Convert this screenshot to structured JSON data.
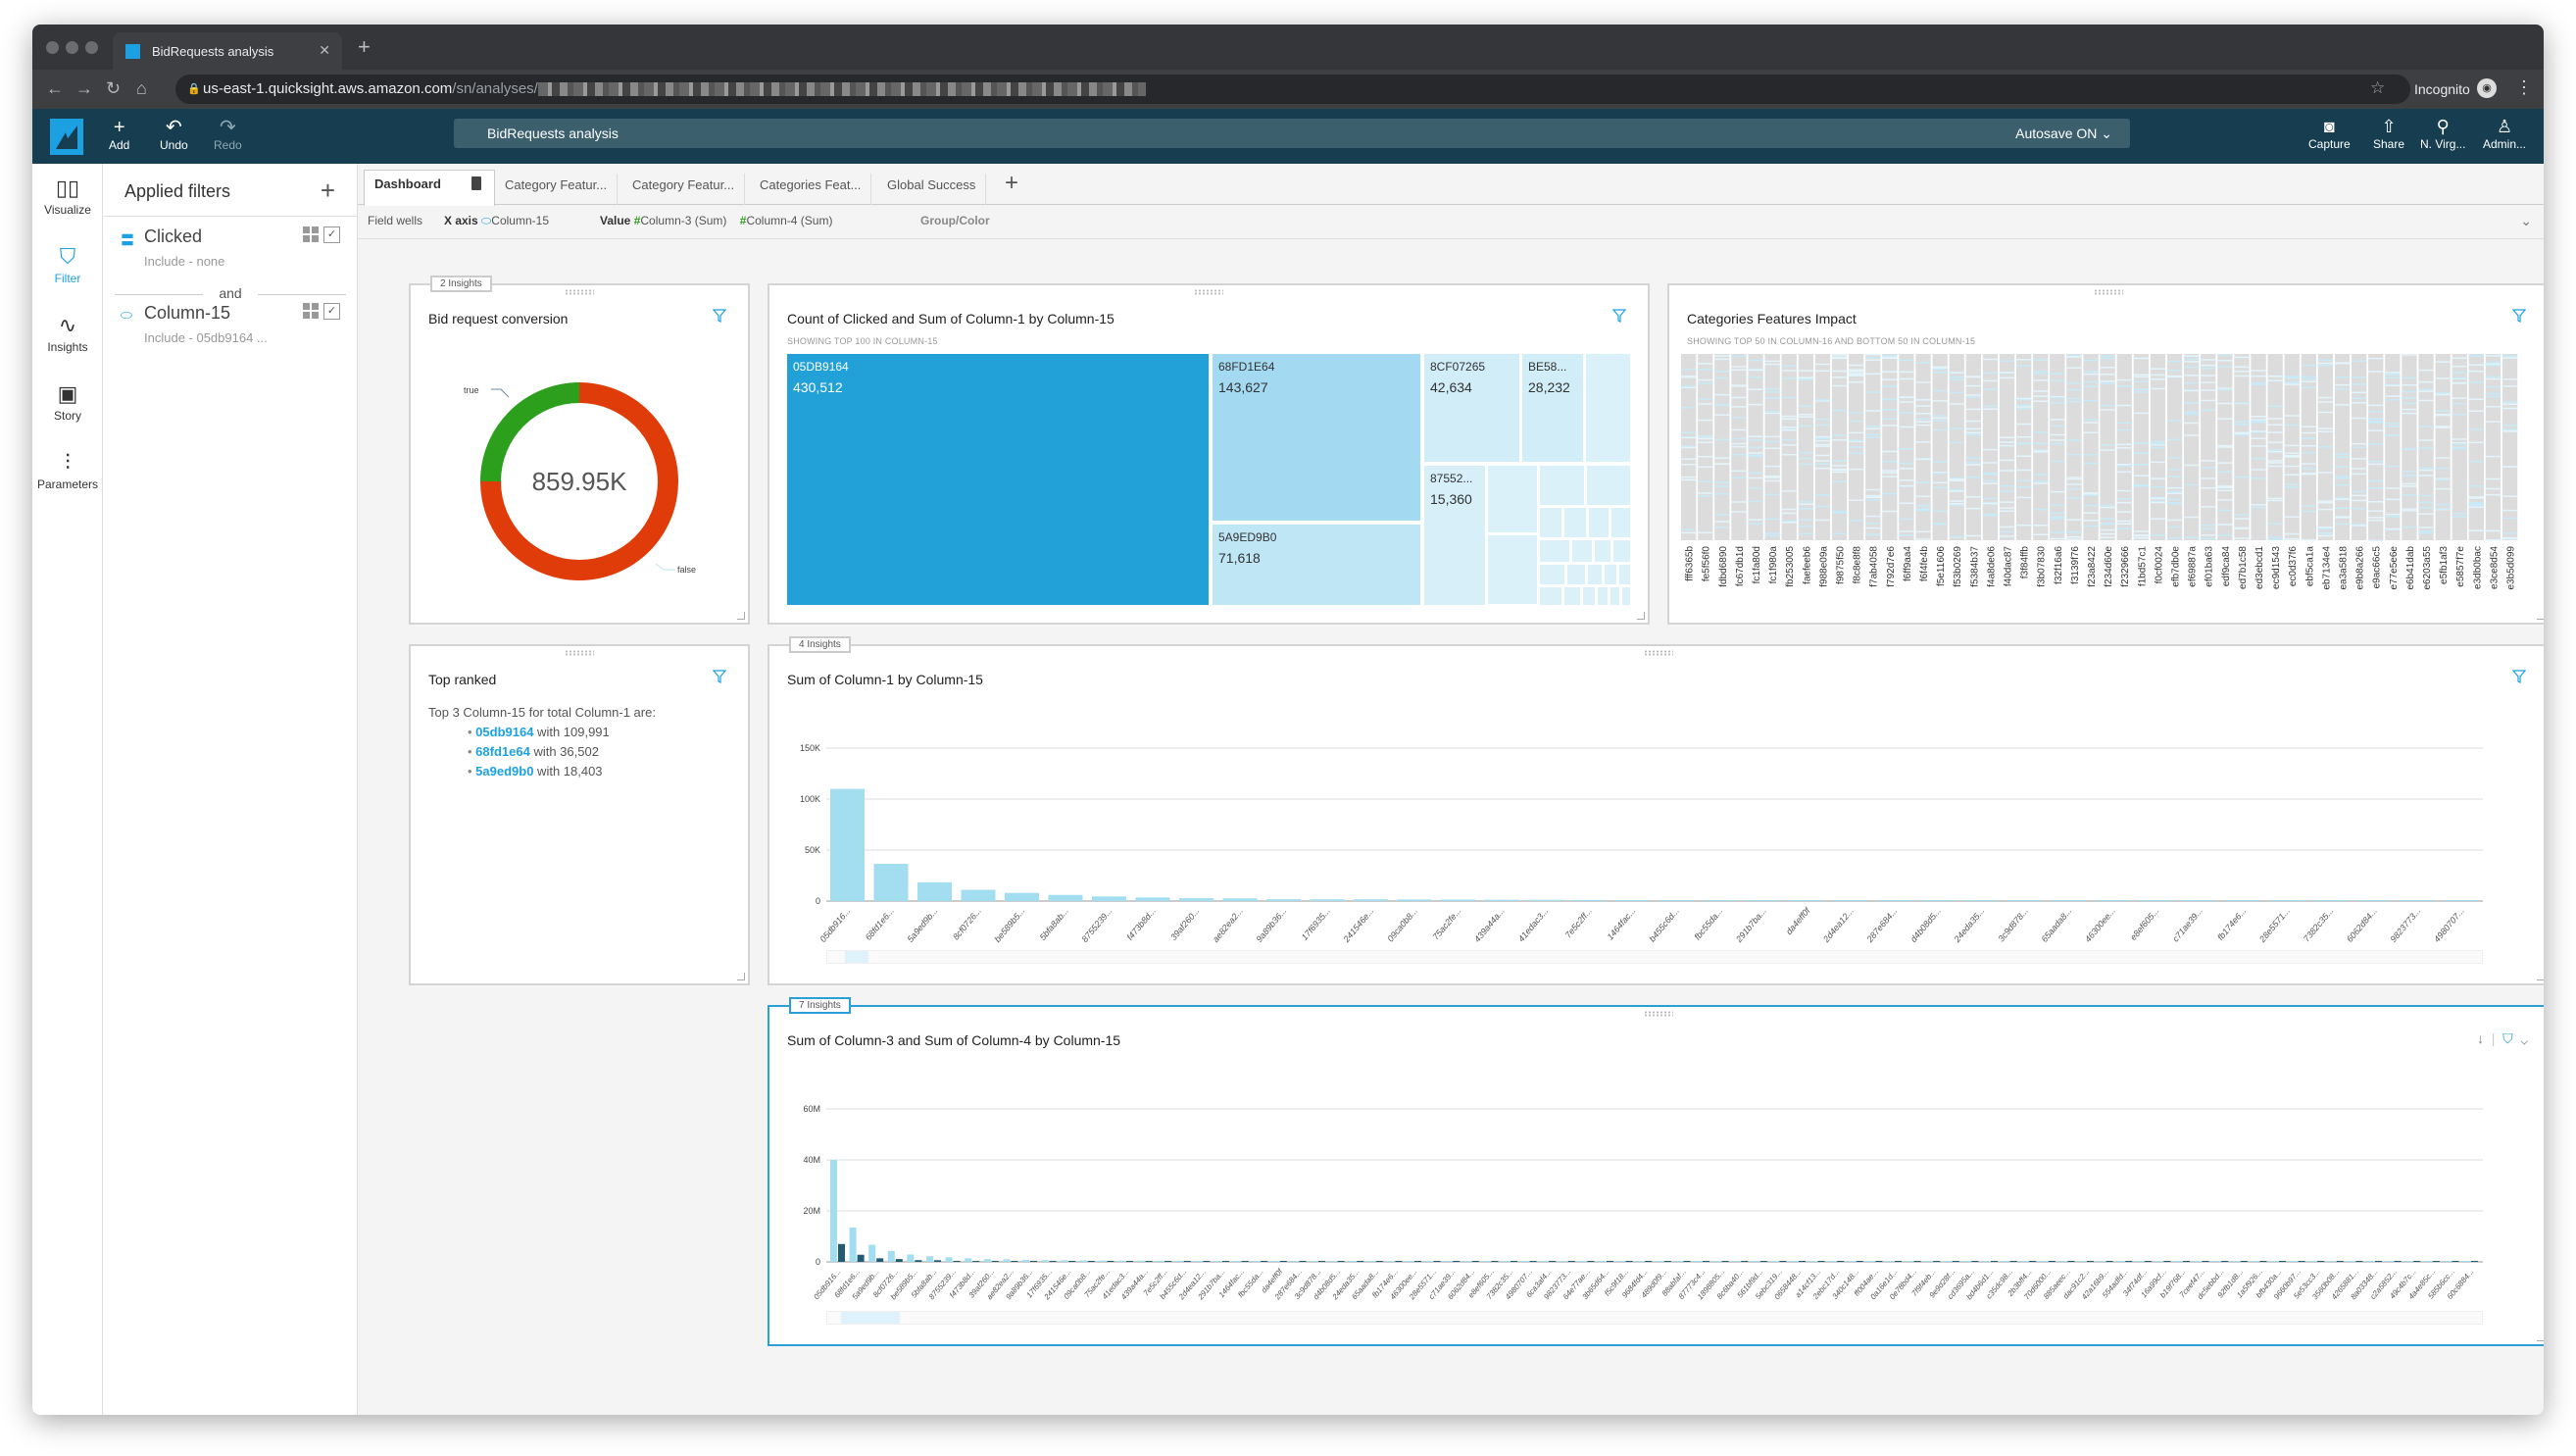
{
  "browser": {
    "tab_title": "BidRequests analysis",
    "url_host": "us-east-1.quicksight.aws.amazon.com",
    "url_path": "/sn/analyses/",
    "incognito_label": "Incognito"
  },
  "appbar": {
    "add": "Add",
    "undo": "Undo",
    "redo": "Redo",
    "analysis_title": "BidRequests analysis",
    "autosave": "Autosave ON",
    "capture": "Capture",
    "share": "Share",
    "region": "N. Virg...",
    "user": "Admin..."
  },
  "rail": {
    "items": [
      {
        "label": "Visualize",
        "icon": "bar-chart-icon"
      },
      {
        "label": "Filter",
        "icon": "filter-icon",
        "active": true
      },
      {
        "label": "Insights",
        "icon": "insights-icon"
      },
      {
        "label": "Story",
        "icon": "story-icon"
      },
      {
        "label": "Parameters",
        "icon": "parameters-icon"
      }
    ]
  },
  "filters": {
    "title": "Applied filters",
    "joiner": "and",
    "items": [
      {
        "name": "Clicked",
        "sub": "Include - none",
        "icon": "measure-icon"
      },
      {
        "name": "Column-15",
        "sub": "Include - 05db9164 ...",
        "icon": "dimension-tag-icon"
      }
    ]
  },
  "sheets": {
    "tabs": [
      "Dashboard",
      "Category Featur...",
      "Category Featur...",
      "Categories Feat...",
      "Global Success"
    ],
    "active": 0
  },
  "fieldwells": {
    "label": "Field wells",
    "xaxis_label": "X axis",
    "xaxis_value": "Column-15",
    "value_label": "Value",
    "values": [
      "Column-3 (Sum)",
      "Column-4 (Sum)"
    ],
    "group_label": "Group/Color"
  },
  "colors": {
    "accent": "#1ba1e2",
    "appbar": "#163e50",
    "donut_true": "#2ca01c",
    "donut_false": "#e03c0a",
    "bar_light": "#a3ddf0",
    "bar_dark": "#235a74"
  },
  "cards": {
    "donut": {
      "insights": "2 Insights",
      "title": "Bid request conversion",
      "center": "859.95K"
    },
    "top_ranked": {
      "title": "Top ranked",
      "intro": "Top 3 Column-15 for total Column-1 are:",
      "items": [
        {
          "key": "05db9164",
          "rest": " with 109,991"
        },
        {
          "key": "68fd1e64",
          "rest": " with 36,502"
        },
        {
          "key": "5a9ed9b0",
          "rest": " with 18,403"
        }
      ]
    },
    "treemap": {
      "title": "Count of Clicked and Sum of Column-1 by Column-15",
      "subtitle": "SHOWING TOP 100 IN COLUMN-15"
    },
    "heatmap": {
      "title": "Categories Features Impact",
      "subtitle": "SHOWING TOP 50 IN COLUMN-16 AND BOTTOM 50 IN COLUMN-15"
    },
    "bar1": {
      "insights": "4 Insights",
      "title": "Sum of Column-1 by Column-15"
    },
    "bar2": {
      "insights": "7 Insights",
      "title": "Sum of Column-3 and Sum of Column-4 by Column-15"
    }
  },
  "chart_data": [
    {
      "id": "donut",
      "type": "pie",
      "title": "Bid request conversion",
      "center_label": "859.95K",
      "categories": [
        "true",
        "false"
      ],
      "values": [
        0.25,
        0.75
      ],
      "value_unit": "fraction"
    },
    {
      "id": "treemap",
      "type": "treemap",
      "title": "Count of Clicked and Sum of Column-1 by Column-15",
      "items": [
        {
          "label": "05DB9164",
          "value": 430512
        },
        {
          "label": "68FD1E64",
          "value": 143627
        },
        {
          "label": "5A9ED9B0",
          "value": 71618
        },
        {
          "label": "8CF07265",
          "value": 42634
        },
        {
          "label": "BE58...",
          "value": 28232
        },
        {
          "label": "87552...",
          "value": 15360
        }
      ]
    },
    {
      "id": "heatmap",
      "type": "heatmap",
      "title": "Categories Features Impact",
      "columns": [
        "fff6365b",
        "fe5f56f0",
        "fdbd6890",
        "fc67db1d",
        "fc1fa80d",
        "fc1f980a",
        "fb253005",
        "faefeeb6",
        "f988e09a",
        "f9875f50",
        "f8c8e8f8",
        "f7ab4058",
        "f792d7e6",
        "f6ff9aa4",
        "f6f4fe4b",
        "f5e11606",
        "f53b0269",
        "f5384b37",
        "f4a8de06",
        "f40dac87",
        "f3f84ffb",
        "f3b07830",
        "f32f16a6",
        "f3139f76",
        "f23a8422",
        "f234d60e",
        "f2329666",
        "f1bd57c1",
        "f0cf0024",
        "efb7db0e",
        "ef69887a",
        "ef01ba63",
        "edf9ca84",
        "ed7b1c58",
        "ed3ebcd1",
        "ec9d1543",
        "ec0d37f6",
        "ebf5ca1a",
        "eb7134e4",
        "ea3a5818",
        "e9b8a266",
        "e9ac66c5",
        "e77e5e6e",
        "e6b41dab",
        "e6203a55",
        "e5fb1af3",
        "e5857f7e",
        "e3db0bac",
        "e3ce8d54",
        "e3b5d099"
      ]
    },
    {
      "id": "bar1",
      "type": "bar",
      "title": "Sum of Column-1 by Column-15",
      "ylim": [
        0,
        150000
      ],
      "yticks": [
        "0",
        "50K",
        "100K",
        "150K"
      ],
      "ytick_values": [
        0,
        50000,
        100000,
        150000
      ],
      "categories": [
        "05db916...",
        "68fd1e6...",
        "5a9ed9b...",
        "8cf0726...",
        "be589b5...",
        "5bfa8ab...",
        "8755239...",
        "f473b8d...",
        "39af260...",
        "ae82ea2...",
        "9a89b36...",
        "17f6935...",
        "241546e...",
        "09ca0b8...",
        "75ac2fe...",
        "439a44a...",
        "41edac3...",
        "7e5c2ff...",
        "1464fac...",
        "b455c6d...",
        "fbc55da...",
        "291b7ba...",
        "da4eff0f",
        "2d4ea12...",
        "287e684...",
        "d4b08d5...",
        "24eda35...",
        "3c9d878...",
        "65aada8...",
        "46300ee...",
        "e8ef605...",
        "c71ae39...",
        "fb174e6...",
        "28e5571...",
        "7382c35...",
        "6062d84...",
        "9823773...",
        "4980707..."
      ],
      "values": [
        109991,
        36502,
        18403,
        11000,
        8000,
        6000,
        4500,
        3500,
        2800,
        2600,
        1800,
        1700,
        1700,
        1600,
        1500,
        1300,
        1200,
        1100,
        1000,
        950,
        900,
        880,
        860,
        840,
        820,
        800,
        780,
        760,
        740,
        720,
        700,
        680,
        660,
        640,
        620,
        600,
        580,
        560
      ]
    },
    {
      "id": "bar2",
      "type": "bar",
      "title": "Sum of Column-3 and Sum of Column-4 by Column-15",
      "ylim": [
        0,
        60000000
      ],
      "yticks": [
        "0",
        "20M",
        "40M",
        "60M"
      ],
      "ytick_values": [
        0,
        20000000,
        40000000,
        60000000
      ],
      "categories": [
        "05db916...",
        "68fd1e6...",
        "5a9ed9b...",
        "8cf0726...",
        "be589b5...",
        "5bfa8ab...",
        "8755239...",
        "f473b8d...",
        "39af260...",
        "ae82ea2...",
        "9a89b36...",
        "17f6935...",
        "241546e...",
        "09ca0b8...",
        "75ac2fe...",
        "41edac3...",
        "439a44a...",
        "7e5c2ff...",
        "b455c6d...",
        "2d4ea12...",
        "291b7ba...",
        "1464fac...",
        "fbc55da...",
        "da4eff0f",
        "287e684...",
        "3c9d878...",
        "d4b08d5...",
        "24eda35...",
        "65aada8...",
        "fb174e6...",
        "46300ee...",
        "28e5571...",
        "c71ae39...",
        "6062d84...",
        "e8ef605...",
        "7382c35...",
        "4980707...",
        "6ca3af4...",
        "9823773...",
        "64e77ae...",
        "3b65d64...",
        "f5c9f18...",
        "9684fd4...",
        "489d0f9...",
        "88abfaf...",
        "87773c4...",
        "1898805...",
        "8c6ba40...",
        "561bf9d...",
        "5ebc319...",
        "0658448...",
        "a14cf13...",
        "2ebc17d...",
        "340c148...",
        "ff004ae...",
        "0a16e1d...",
        "0e78bd4...",
        "7f9f4eb...",
        "9e9d28f...",
        "cd3695a...",
        "bd4b6d1...",
        "c35dc98...",
        "2b3bff4...",
        "70d6000...",
        "885aeec...",
        "dac91c2...",
        "42a16b9...",
        "554adfd...",
        "34f74df...",
        "16a99cf...",
        "b19f768...",
        "7ceef47...",
        "dc5ebbd...",
        "92fb1d8...",
        "1a5f926...",
        "bfb430a...",
        "9660b97...",
        "5e53cc3...",
        "3560b08...",
        "4265881...",
        "8a03348...",
        "c2a5852...",
        "49c4b7c...",
        "4a4e85c...",
        "585b6cc...",
        "60c6884..."
      ],
      "series": [
        {
          "name": "Column-3 (Sum)",
          "color": "#a3ddf0",
          "values": [
            40000000,
            13500000,
            6700000,
            4300000,
            2900000,
            2200000,
            1800000,
            1400000,
            1100000,
            1000000,
            800000,
            700000,
            650000,
            600000,
            550000,
            500000,
            480000,
            460000,
            440000,
            420000,
            400000,
            380000,
            360000,
            350000,
            340000,
            330000,
            320000,
            310000,
            300000,
            290000,
            280000,
            270000,
            260000,
            250000,
            240000,
            230000,
            220000,
            210000,
            200000,
            190000,
            180000,
            170000,
            160000,
            155000,
            150000,
            145000,
            140000,
            135000,
            130000,
            125000,
            120000,
            115000,
            110000,
            105000,
            100000,
            95000,
            90000,
            85000,
            80000,
            78000,
            76000,
            74000,
            72000,
            70000,
            68000,
            66000,
            64000,
            62000,
            60000,
            58000,
            56000,
            54000,
            52000,
            50000,
            48000,
            46000,
            44000,
            42000,
            40000,
            38000,
            36000,
            34000,
            32000,
            30000,
            28000,
            26000
          ]
        },
        {
          "name": "Column-4 (Sum)",
          "color": "#235a74",
          "values": [
            7000000,
            2800000,
            1400000,
            1100000,
            700000,
            650000,
            400000,
            350000,
            300000,
            280000,
            250000,
            240000,
            230000,
            220000,
            210000,
            200000,
            190000,
            180000,
            170000,
            160000,
            150000,
            140000,
            130000,
            120000,
            110000,
            100000,
            95000,
            90000,
            85000,
            80000,
            75000,
            70000,
            68000,
            66000,
            64000,
            62000,
            60000,
            58000,
            56000,
            54000,
            52000,
            50000,
            48000,
            46000,
            44000,
            42000,
            40000,
            38000,
            36000,
            34000,
            32000,
            30000,
            28000,
            26000,
            24000,
            22000,
            20000,
            19000,
            18000,
            17000,
            16000,
            15000,
            14000,
            13000,
            12000,
            11000,
            10000,
            9500,
            9000,
            8500,
            8000,
            7500,
            7000,
            6500,
            6000,
            5500,
            5000,
            4800,
            4600,
            4400,
            4200,
            4000,
            3800,
            3600,
            3400,
            3200
          ]
        }
      ]
    }
  ]
}
